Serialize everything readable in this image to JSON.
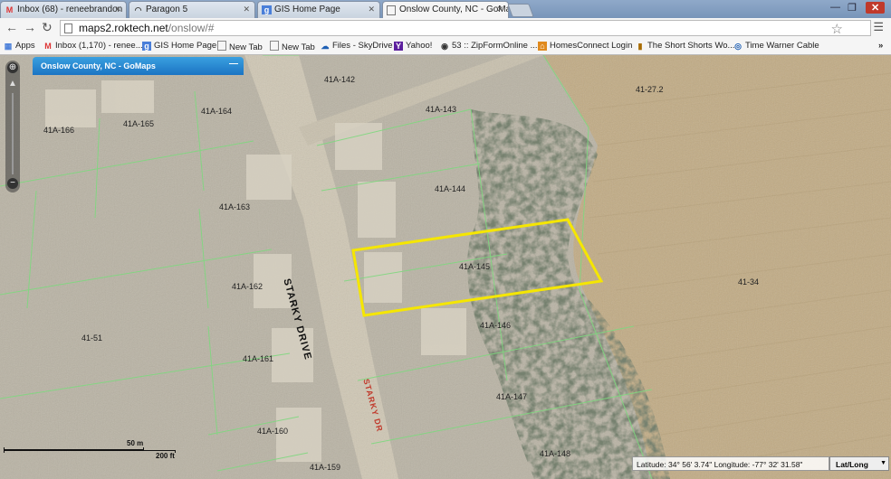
{
  "tabs": [
    {
      "title": "Inbox (68) - reneebrandon",
      "icon": "gmail-icon"
    },
    {
      "title": "Paragon 5",
      "icon": "paragon-icon"
    },
    {
      "title": "GIS Home Page",
      "icon": "google-icon"
    },
    {
      "title": "Onslow County, NC - GoMaps",
      "icon": "page-icon"
    }
  ],
  "address": {
    "host": "maps2.roktech.net",
    "path": "/onslow/#"
  },
  "bookmarks": [
    {
      "label": "Apps",
      "icon": "apps-icon"
    },
    {
      "label": "Inbox (1,170) - renee...",
      "icon": "gmail-icon"
    },
    {
      "label": "GIS Home Page",
      "icon": "google-icon"
    },
    {
      "label": "New Tab",
      "icon": "page-icon"
    },
    {
      "label": "New Tab",
      "icon": "page-icon"
    },
    {
      "label": "Files - SkyDrive",
      "icon": "skydrive-icon"
    },
    {
      "label": "Yahoo!",
      "icon": "yahoo-icon"
    },
    {
      "label": "53 :: ZipFormOnline ...",
      "icon": "zipform-icon"
    },
    {
      "label": "HomesConnect Login",
      "icon": "homesconnect-icon"
    },
    {
      "label": "The Short Shorts Wo...",
      "icon": "bookmark-icon"
    },
    {
      "label": "Time Warner Cable",
      "icon": "twc-icon"
    }
  ],
  "panel_title": "Onslow County, NC - GoMaps",
  "parcels": [
    "41A-142",
    "41A-143",
    "41-27.2",
    "41A-164",
    "41A-165",
    "41A-166",
    "41A-144",
    "41A-163",
    "41A-145",
    "41A-162",
    "41-34",
    "41A-146",
    "41-51",
    "41A-161",
    "41A-147",
    "41A-160",
    "41A-148",
    "41A-159"
  ],
  "streets": {
    "main": "STARKY DRIVE",
    "secondary": "STARKY DR"
  },
  "scale": {
    "metric": "50 m",
    "imperial": "200 ft"
  },
  "coordinates": {
    "latitude_label": "Latitude:",
    "latitude": "34° 56' 3.74\"",
    "longitude_label": "Longitude:",
    "longitude": "-77° 32' 31.58\""
  },
  "coord_mode": "Lat/Long",
  "colors": {
    "highlight": "#f5e600",
    "parcel_line": "#7fd87f"
  }
}
